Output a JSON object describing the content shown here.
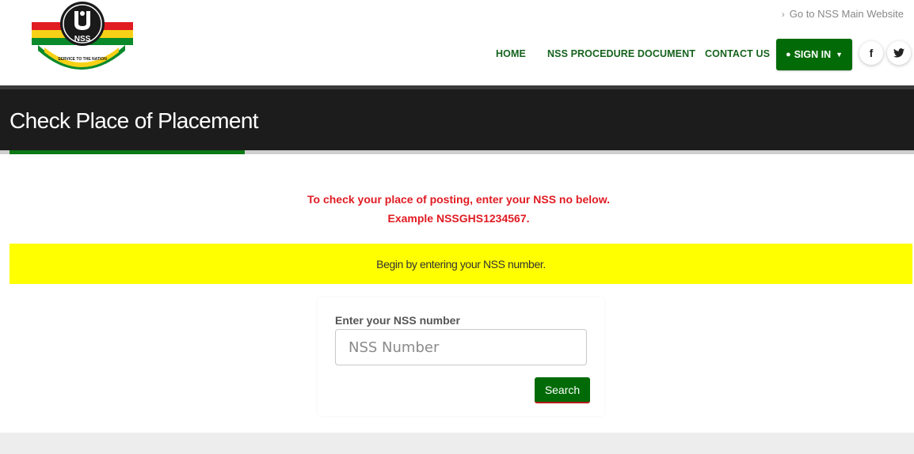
{
  "header": {
    "logo_alt": "NSS SERVICE TO THE NATION",
    "logo_text": "NSS",
    "logo_motto": "SERVICE TO THE NATION",
    "main_site_link": "Go to NSS Main Website",
    "nav": [
      {
        "label": "HOME"
      },
      {
        "label": "NSS PROCEDURE DOCUMENT"
      },
      {
        "label": "CONTACT US"
      }
    ],
    "signin_label": "SIGN IN",
    "social": [
      {
        "icon": "facebook-icon",
        "glyph": "f"
      },
      {
        "icon": "twitter-icon",
        "glyph": "t"
      }
    ]
  },
  "page": {
    "title": "Check Place of Placement",
    "instruction_line1": "To check your place of posting, enter your NSS no below.",
    "instruction_line2": "Example NSSGHS1234567.",
    "alert": "Begin by entering your NSS number."
  },
  "form": {
    "label": "Enter your NSS number",
    "placeholder": "NSS Number",
    "value": "",
    "submit_label": "Search"
  },
  "colors": {
    "brand_green": "#026b07",
    "nav_green": "#16631e",
    "alert_yellow": "#ffff00",
    "instruction_red": "#e01b22",
    "title_bar": "#1c1c1c"
  }
}
